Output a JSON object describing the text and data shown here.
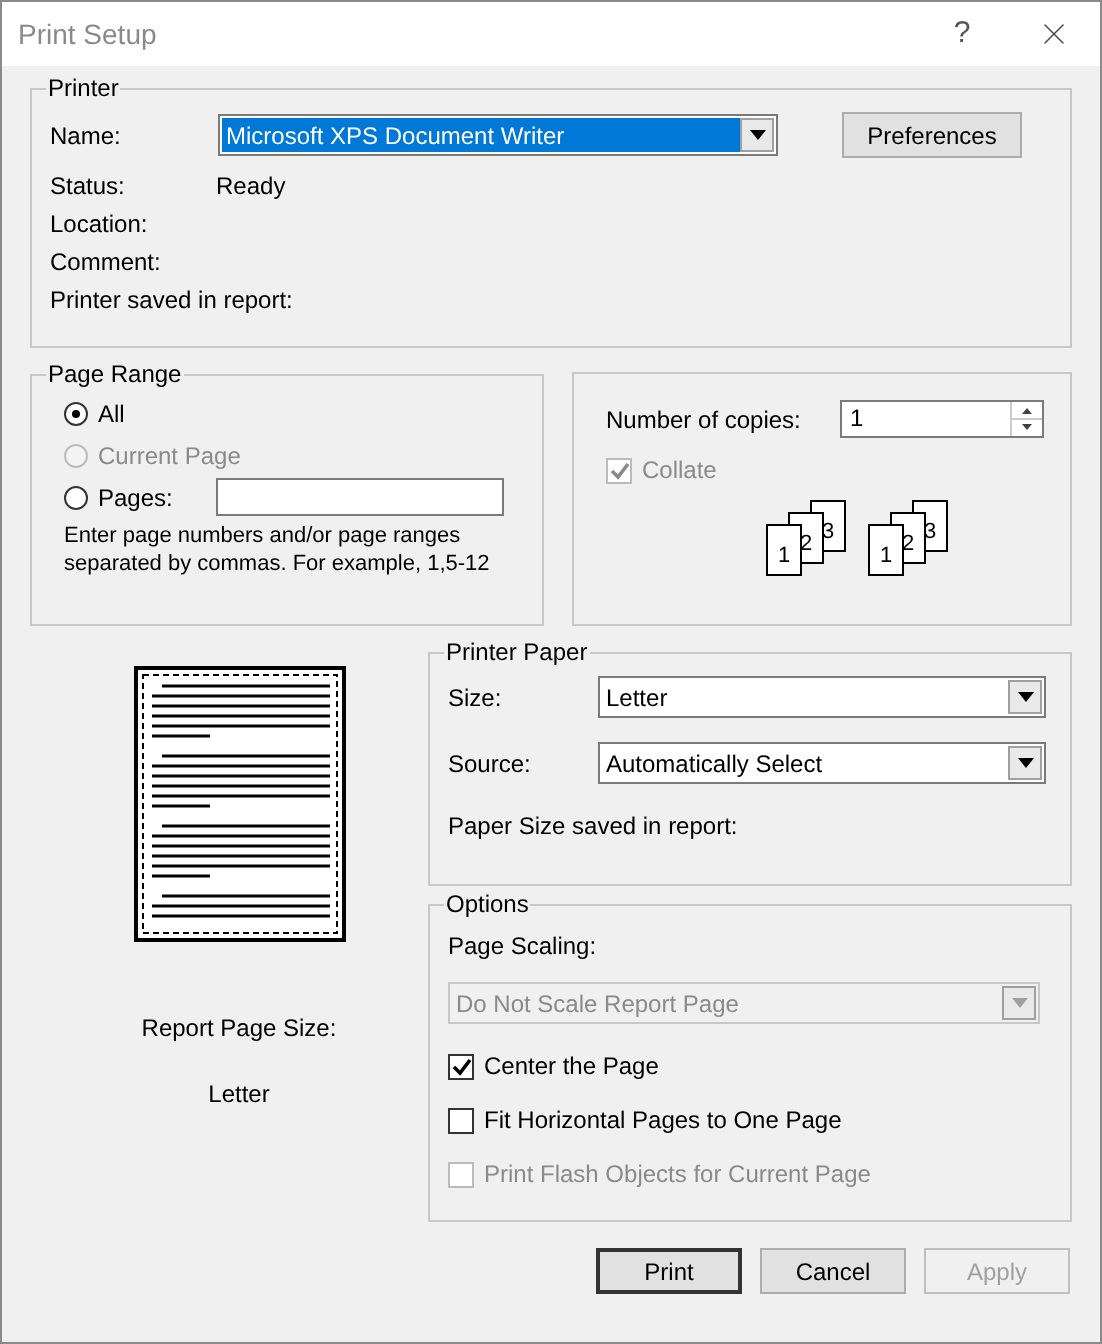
{
  "window": {
    "title": "Print Setup",
    "help": "?"
  },
  "printer": {
    "legend": "Printer",
    "name_label": "Name:",
    "name_value": "Microsoft XPS Document Writer",
    "preferences": "Preferences",
    "fields": [
      {
        "label": "Status:",
        "value": "Ready"
      },
      {
        "label": "Location:"
      },
      {
        "label": "Comment:"
      },
      {
        "label": "Printer saved in report:"
      }
    ]
  },
  "page_range": {
    "legend": "Page Range",
    "options": [
      {
        "label": "All",
        "selected": true,
        "disabled": false
      },
      {
        "label": "Current Page",
        "selected": false,
        "disabled": true
      },
      {
        "label": "Pages:",
        "selected": false,
        "disabled": false
      }
    ],
    "hint": "Enter page numbers and/or page ranges separated by commas. For example, 1,5-12"
  },
  "copies": {
    "label": "Number of copies:",
    "value": "1",
    "collate": {
      "label": "Collate",
      "checked": true,
      "disabled": true
    },
    "stacks": [
      [
        "1",
        "2",
        "3"
      ],
      [
        "1",
        "2",
        "3"
      ]
    ]
  },
  "preview": {
    "size_label": "Report Page Size:",
    "size_value": "Letter"
  },
  "paper": {
    "legend": "Printer Paper",
    "size_label": "Size:",
    "size_value": "Letter",
    "source_label": "Source:",
    "source_value": "Automatically Select",
    "saved_label": "Paper Size saved in report:"
  },
  "options": {
    "legend": "Options",
    "scaling_label": "Page Scaling:",
    "scaling_value": "Do Not Scale Report Page",
    "scaling_disabled": true,
    "checks": [
      {
        "label": "Center the Page",
        "checked": true,
        "disabled": false
      },
      {
        "label": "Fit Horizontal Pages to One Page",
        "checked": false,
        "disabled": false
      },
      {
        "label": "Print Flash Objects for Current Page",
        "checked": false,
        "disabled": true
      }
    ]
  },
  "buttons": [
    {
      "label": "Print",
      "disabled": false,
      "default": true
    },
    {
      "label": "Cancel",
      "disabled": false,
      "default": false
    },
    {
      "label": "Apply",
      "disabled": true,
      "default": false
    }
  ]
}
